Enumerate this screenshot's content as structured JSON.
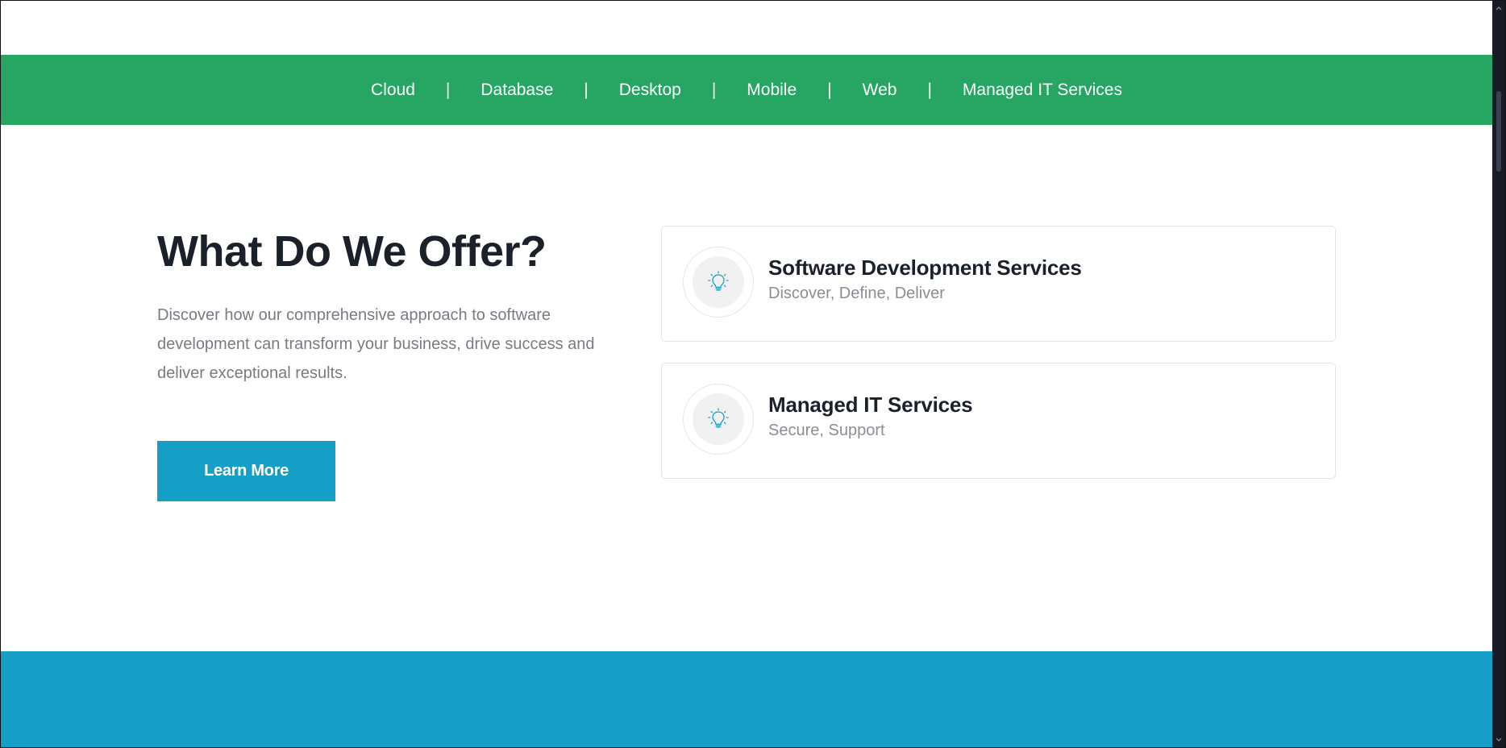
{
  "colors": {
    "nav_green": "#27a562",
    "accent_blue": "#169fc6",
    "heading": "#1b212b",
    "body_text": "#777b82",
    "card_border": "#e3e5e8",
    "icon_stroke": "#169fc6",
    "scrollbar": "#171b26"
  },
  "tech_nav": {
    "items": [
      {
        "label": "Cloud"
      },
      {
        "label": "Database"
      },
      {
        "label": "Desktop"
      },
      {
        "label": "Mobile"
      },
      {
        "label": "Web"
      },
      {
        "label": "Managed IT Services"
      }
    ],
    "separator": "|"
  },
  "intro": {
    "title": "What Do We Offer?",
    "description": "Discover how our comprehensive approach to software development can transform your business, drive success and deliver exceptional results.",
    "button_label": "Learn More"
  },
  "services": [
    {
      "title": "Software Development Services",
      "subtitle": "Discover, Define, Deliver",
      "icon": "lightbulb-icon"
    },
    {
      "title": "Managed IT Services",
      "subtitle": "Secure, Support",
      "icon": "lightbulb-icon"
    }
  ]
}
